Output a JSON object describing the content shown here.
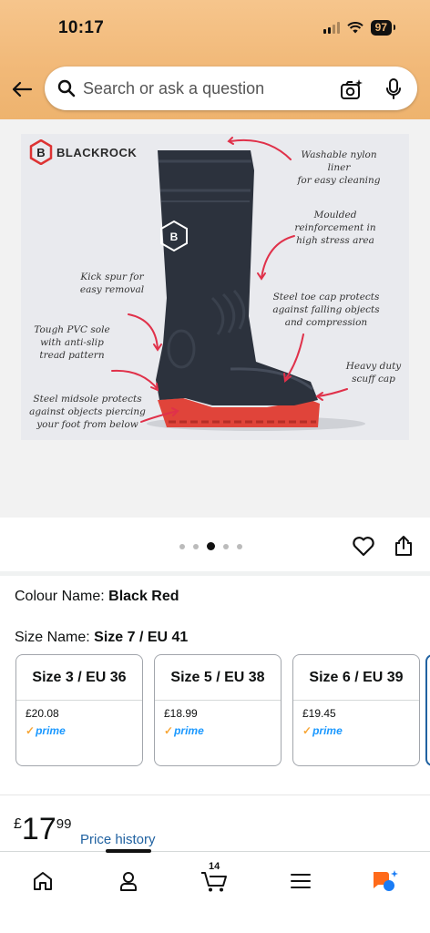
{
  "status_bar": {
    "time": "10:17",
    "battery": "97"
  },
  "search": {
    "placeholder": "Search or ask a question"
  },
  "product_image": {
    "brand": "BLACKROCK",
    "annotations": {
      "liner": "Washable nylon liner\nfor easy cleaning",
      "reinforcement": "Moulded\nreinforcement in\nhigh stress area",
      "kick_spur": "Kick spur for\neasy removal",
      "toe_cap": "Steel toe cap protects\nagainst falling objects\nand compression",
      "sole": "Tough PVC sole\nwith anti-slip\ntread pattern",
      "scuff_cap": "Heavy duty\nscuff cap",
      "midsole": "Steel midsole protects\nagainst objects piercing\nyour foot from below"
    },
    "image_count": 5,
    "active_index": 2
  },
  "colour": {
    "label": "Colour Name: ",
    "value": "Black Red"
  },
  "size": {
    "label": "Size Name: ",
    "value": "Size 7 / EU 41"
  },
  "size_options": [
    {
      "name": "Size 3 / EU 36",
      "price": "£20.08",
      "prime": "prime"
    },
    {
      "name": "Size 5 / EU 38",
      "price": "£18.99",
      "prime": "prime"
    },
    {
      "name": "Size 6 / EU 39",
      "price": "£19.45",
      "prime": "prime"
    }
  ],
  "price": {
    "currency": "£",
    "whole": "17",
    "fraction": "99",
    "history_label": "Price history"
  },
  "bottom_nav": {
    "cart_count": "14"
  },
  "colors": {
    "header": "#f1b877",
    "link": "#2162a1",
    "prime": "#1a98ff",
    "boot_sole": "#e0443a"
  }
}
